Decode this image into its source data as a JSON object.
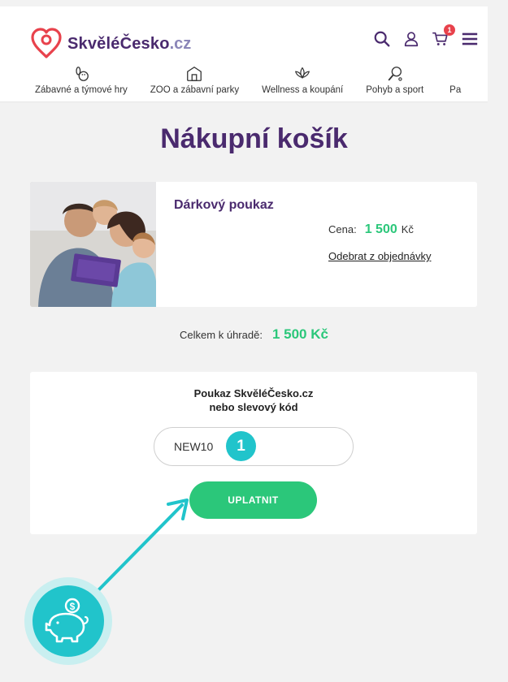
{
  "header": {
    "logo_name": "SkvěléČesko",
    "logo_tld": ".cz",
    "cart_count": "1",
    "icons": [
      "search-icon",
      "user-icon",
      "cart-icon",
      "menu-icon"
    ]
  },
  "categories": [
    {
      "label": "Zábavné a týmové hry",
      "icon": "bowling-icon"
    },
    {
      "label": "ZOO a zábavní parky",
      "icon": "park-icon"
    },
    {
      "label": "Wellness a koupání",
      "icon": "lotus-icon"
    },
    {
      "label": "Pohyb a sport",
      "icon": "racket-icon"
    },
    {
      "label": "Pa",
      "icon": "partial-icon"
    }
  ],
  "page": {
    "title": "Nákupní košík"
  },
  "item": {
    "name": "Dárkový poukaz",
    "price_label": "Cena:",
    "price_value": "1 500",
    "price_currency": "Kč",
    "remove_label": "Odebrat z objednávky"
  },
  "total": {
    "label": "Celkem k úhradě:",
    "value": "1 500 Kč"
  },
  "voucher": {
    "title_line1": "Poukaz SkvěléČesko.cz",
    "title_line2": "nebo slevový kód",
    "code_value": "NEW10",
    "step_number": "1",
    "apply_label": "UPLATNIT"
  },
  "colors": {
    "brand_purple": "#4a2a6e",
    "accent_green": "#2bc77a",
    "accent_teal": "#21c4cb",
    "badge_red": "#e8424c"
  }
}
